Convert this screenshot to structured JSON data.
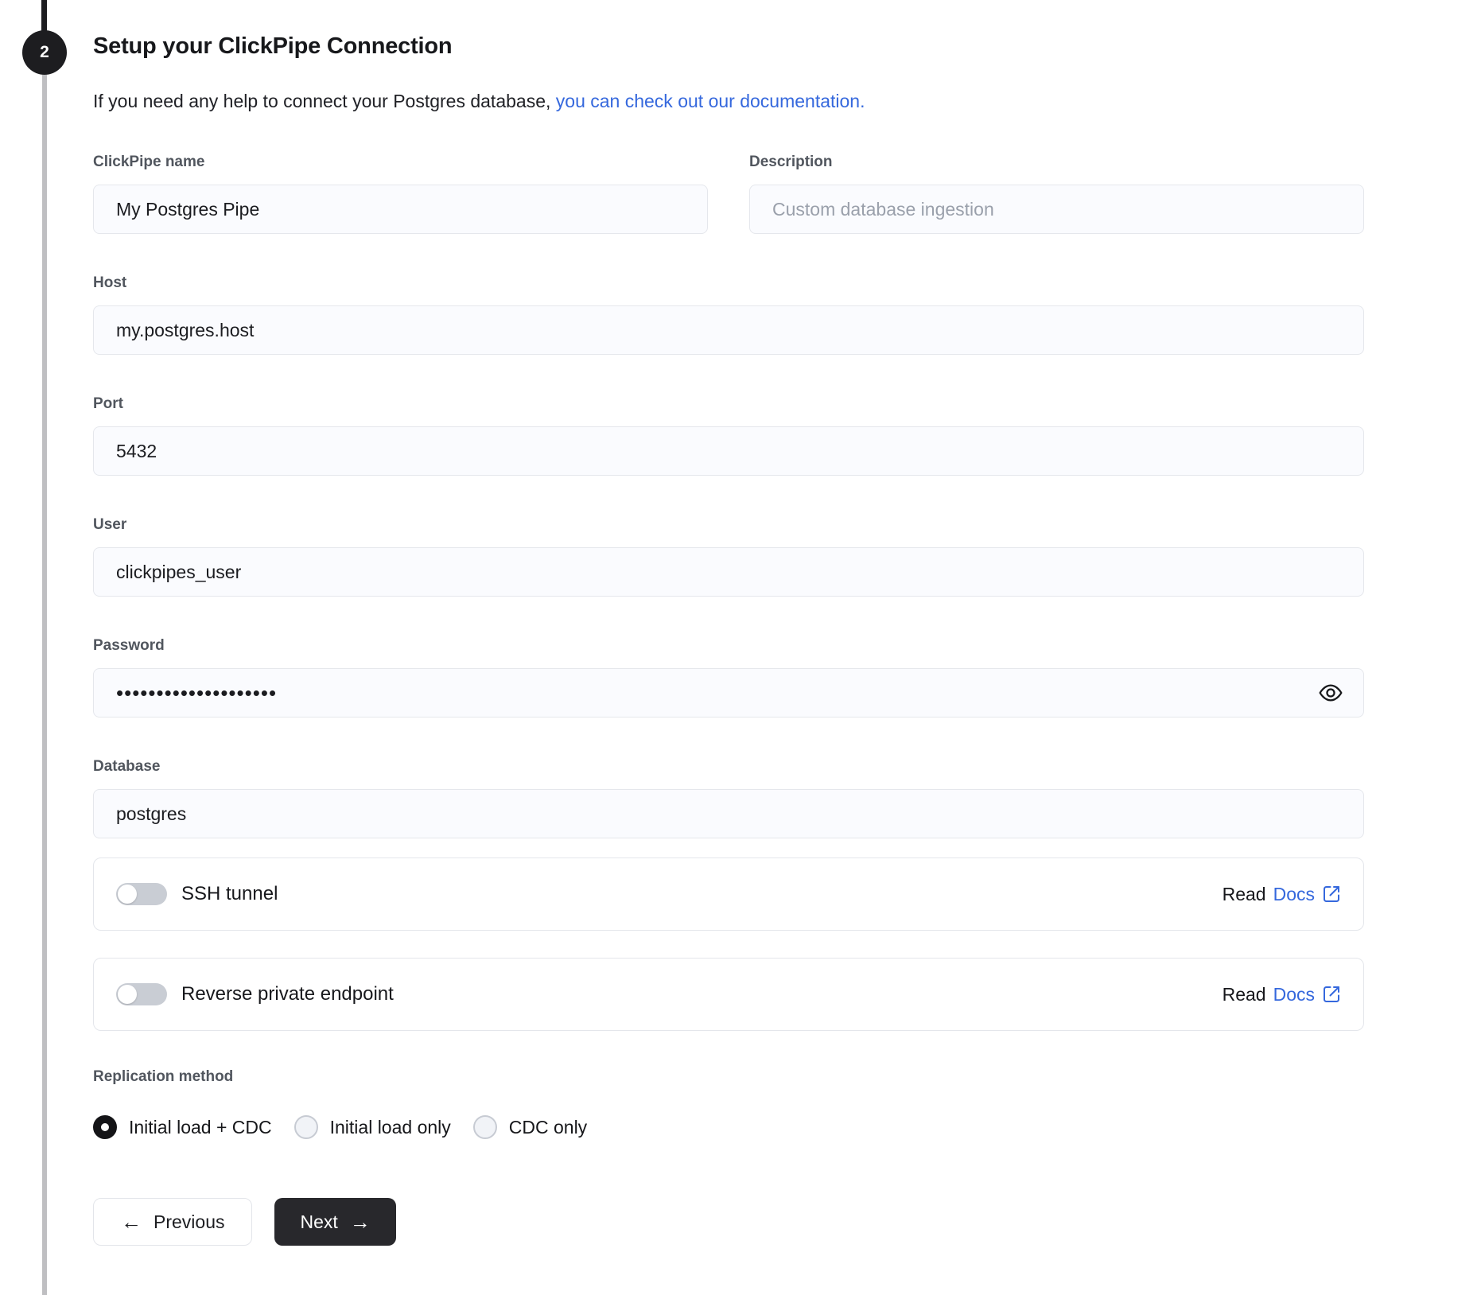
{
  "step": {
    "number": "2"
  },
  "header": {
    "title": "Setup your ClickPipe Connection",
    "subtitle_text": "If you need any help to connect your Postgres database, ",
    "subtitle_link": "you can check out our documentation."
  },
  "form": {
    "clickpipe_name": {
      "label": "ClickPipe name",
      "value": "My Postgres Pipe"
    },
    "description": {
      "label": "Description",
      "placeholder": "Custom database ingestion"
    },
    "host": {
      "label": "Host",
      "value": "my.postgres.host"
    },
    "port": {
      "label": "Port",
      "value": "5432"
    },
    "user": {
      "label": "User",
      "value": "clickpipes_user"
    },
    "password": {
      "label": "Password",
      "masked_value": "••••••••••••••••••••"
    },
    "database": {
      "label": "Database",
      "value": "postgres"
    }
  },
  "toggles": [
    {
      "label": "SSH tunnel",
      "enabled": false,
      "read_label": "Read",
      "docs_label": "Docs"
    },
    {
      "label": "Reverse private endpoint",
      "enabled": false,
      "read_label": "Read",
      "docs_label": "Docs"
    }
  ],
  "replication": {
    "label": "Replication method",
    "options": [
      {
        "label": "Initial load + CDC",
        "selected": true
      },
      {
        "label": "Initial load only",
        "selected": false
      },
      {
        "label": "CDC only",
        "selected": false
      }
    ]
  },
  "actions": {
    "previous_label": "Previous",
    "next_label": "Next"
  },
  "icons": {
    "arrow_left": "←",
    "arrow_right": "→",
    "password_visibility": "eye-icon",
    "docs_external": "external-link-icon"
  },
  "colors": {
    "link_blue": "#3568dd",
    "step_circle": "#1d1d20",
    "toggle_track": "#c9cdd4",
    "next_button_bg": "#28282c"
  }
}
